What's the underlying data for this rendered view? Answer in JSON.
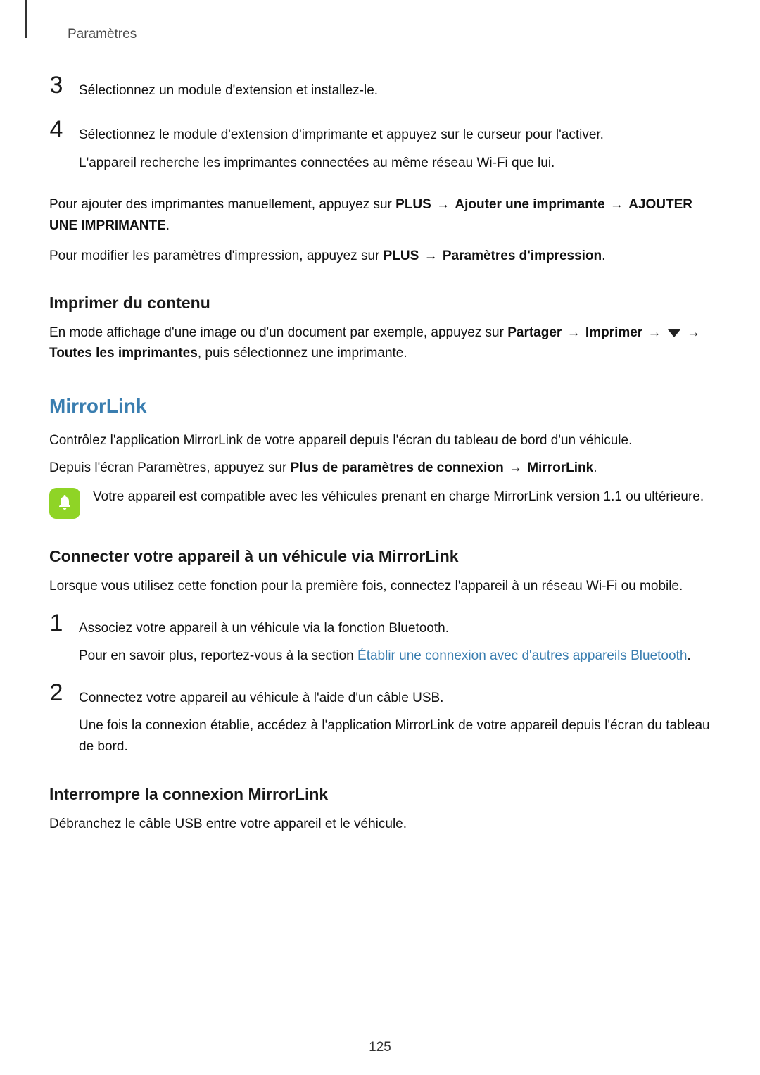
{
  "header": "Paramètres",
  "step3_num": "3",
  "step3_text": "Sélectionnez un module d'extension et installez-le.",
  "step4_num": "4",
  "step4_line1": "Sélectionnez le module d'extension d'imprimante et appuyez sur le curseur pour l'activer.",
  "step4_line2": "L'appareil recherche les imprimantes connectées au même réseau Wi-Fi que lui.",
  "manual_pre": "Pour ajouter des imprimantes manuellement, appuyez sur ",
  "manual_plus": "PLUS",
  "arrow": "→",
  "manual_mid": "Ajouter une imprimante",
  "manual_end": "AJOUTER UNE IMPRIMANTE",
  "period": ".",
  "modify_pre": "Pour modifier les paramètres d'impression, appuyez sur ",
  "modify_plus": "PLUS",
  "modify_end": "Paramètres d'impression",
  "print_heading": "Imprimer du contenu",
  "print_pre": "En mode affichage d'une image ou d'un document par exemple, appuyez sur ",
  "print_partager": "Partager",
  "print_imprimer": "Imprimer",
  "print_toutes": "Toutes les imprimantes",
  "print_post": ", puis sélectionnez une imprimante.",
  "mirror_heading": "MirrorLink",
  "mirror_p1": "Contrôlez l'application MirrorLink de votre appareil depuis l'écran du tableau de bord d'un véhicule.",
  "mirror_p2_pre": "Depuis l'écran Paramètres, appuyez sur ",
  "mirror_p2_b1": "Plus de paramètres de connexion",
  "mirror_p2_b2": "MirrorLink",
  "note_text": "Votre appareil est compatible avec les véhicules prenant en charge MirrorLink version 1.1 ou ultérieure.",
  "connect_heading": "Connecter votre appareil à un véhicule via MirrorLink",
  "connect_intro": "Lorsque vous utilisez cette fonction pour la première fois, connectez l'appareil à un réseau Wi-Fi ou mobile.",
  "c_step1_num": "1",
  "c_step1_l1": "Associez votre appareil à un véhicule via la fonction Bluetooth.",
  "c_step1_l2_pre": "Pour en savoir plus, reportez-vous à la section ",
  "c_step1_link": "Établir une connexion avec d'autres appareils Bluetooth",
  "c_step2_num": "2",
  "c_step2_l1": "Connectez votre appareil au véhicule à l'aide d'un câble USB.",
  "c_step2_l2": "Une fois la connexion établie, accédez à l'application MirrorLink de votre appareil depuis l'écran du tableau de bord.",
  "interrupt_heading": "Interrompre la connexion MirrorLink",
  "interrupt_text": "Débranchez le câble USB entre votre appareil et le véhicule.",
  "page_number": "125"
}
